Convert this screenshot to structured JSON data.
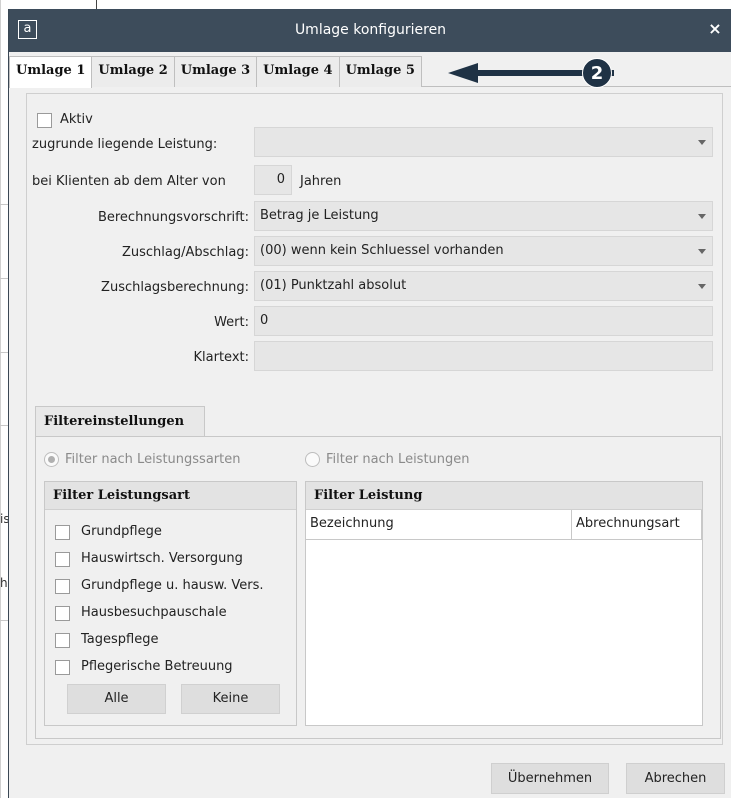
{
  "dialog": {
    "title": "Umlage konfigurieren",
    "logo_letter": "a",
    "close_glyph": "×"
  },
  "tabs": [
    {
      "label": "Umlage 1",
      "active": true
    },
    {
      "label": "Umlage 2",
      "active": false
    },
    {
      "label": "Umlage 3",
      "active": false
    },
    {
      "label": "Umlage 4",
      "active": false
    },
    {
      "label": "Umlage 5",
      "active": false
    }
  ],
  "callout": {
    "number": "2"
  },
  "form": {
    "aktiv_label": "Aktiv",
    "leistung_label": "zugrunde liegende Leistung:",
    "leistung_value": "",
    "alter_label": "bei Klienten ab dem Alter von",
    "alter_value": "0",
    "alter_unit": "Jahren",
    "berechnung_label": "Berechnungsvorschrift:",
    "berechnung_value": "Betrag je Leistung",
    "zuschlag_label": "Zuschlag/Abschlag:",
    "zuschlag_value": "(00) wenn kein Schluessel vorhanden",
    "zuschlagsberechnung_label": "Zuschlagsberechnung:",
    "zuschlagsberechnung_value": "(01) Punktzahl absolut",
    "wert_label": "Wert:",
    "wert_value": "0",
    "klartext_label": "Klartext:",
    "klartext_value": ""
  },
  "filter": {
    "tab_label": "Filtereinstellungen",
    "radio_leistungsarten": "Filter nach Leistungssarten",
    "radio_leistungen": "Filter nach Leistungen",
    "leistungsart_header": "Filter Leistungsart",
    "leistungsart_items": [
      "Grundpflege",
      "Hauswirtsch. Versorgung",
      "Grundpflege u. hausw. Vers.",
      "Hausbesuchpauschale",
      "Tagespflege",
      "Pflegerische Betreuung"
    ],
    "alle_label": "Alle",
    "keine_label": "Keine",
    "leistung_header": "Filter Leistung",
    "columns": [
      "Bezeichnung",
      "Abrechnungsart"
    ]
  },
  "footer": {
    "ok_label": "Übernehmen",
    "cancel_label": "Abrechen"
  },
  "background": {
    "fragments": [
      "is",
      "h"
    ]
  },
  "colors": {
    "titlebar": "#3d4c5b",
    "callout": "#1f3245"
  }
}
